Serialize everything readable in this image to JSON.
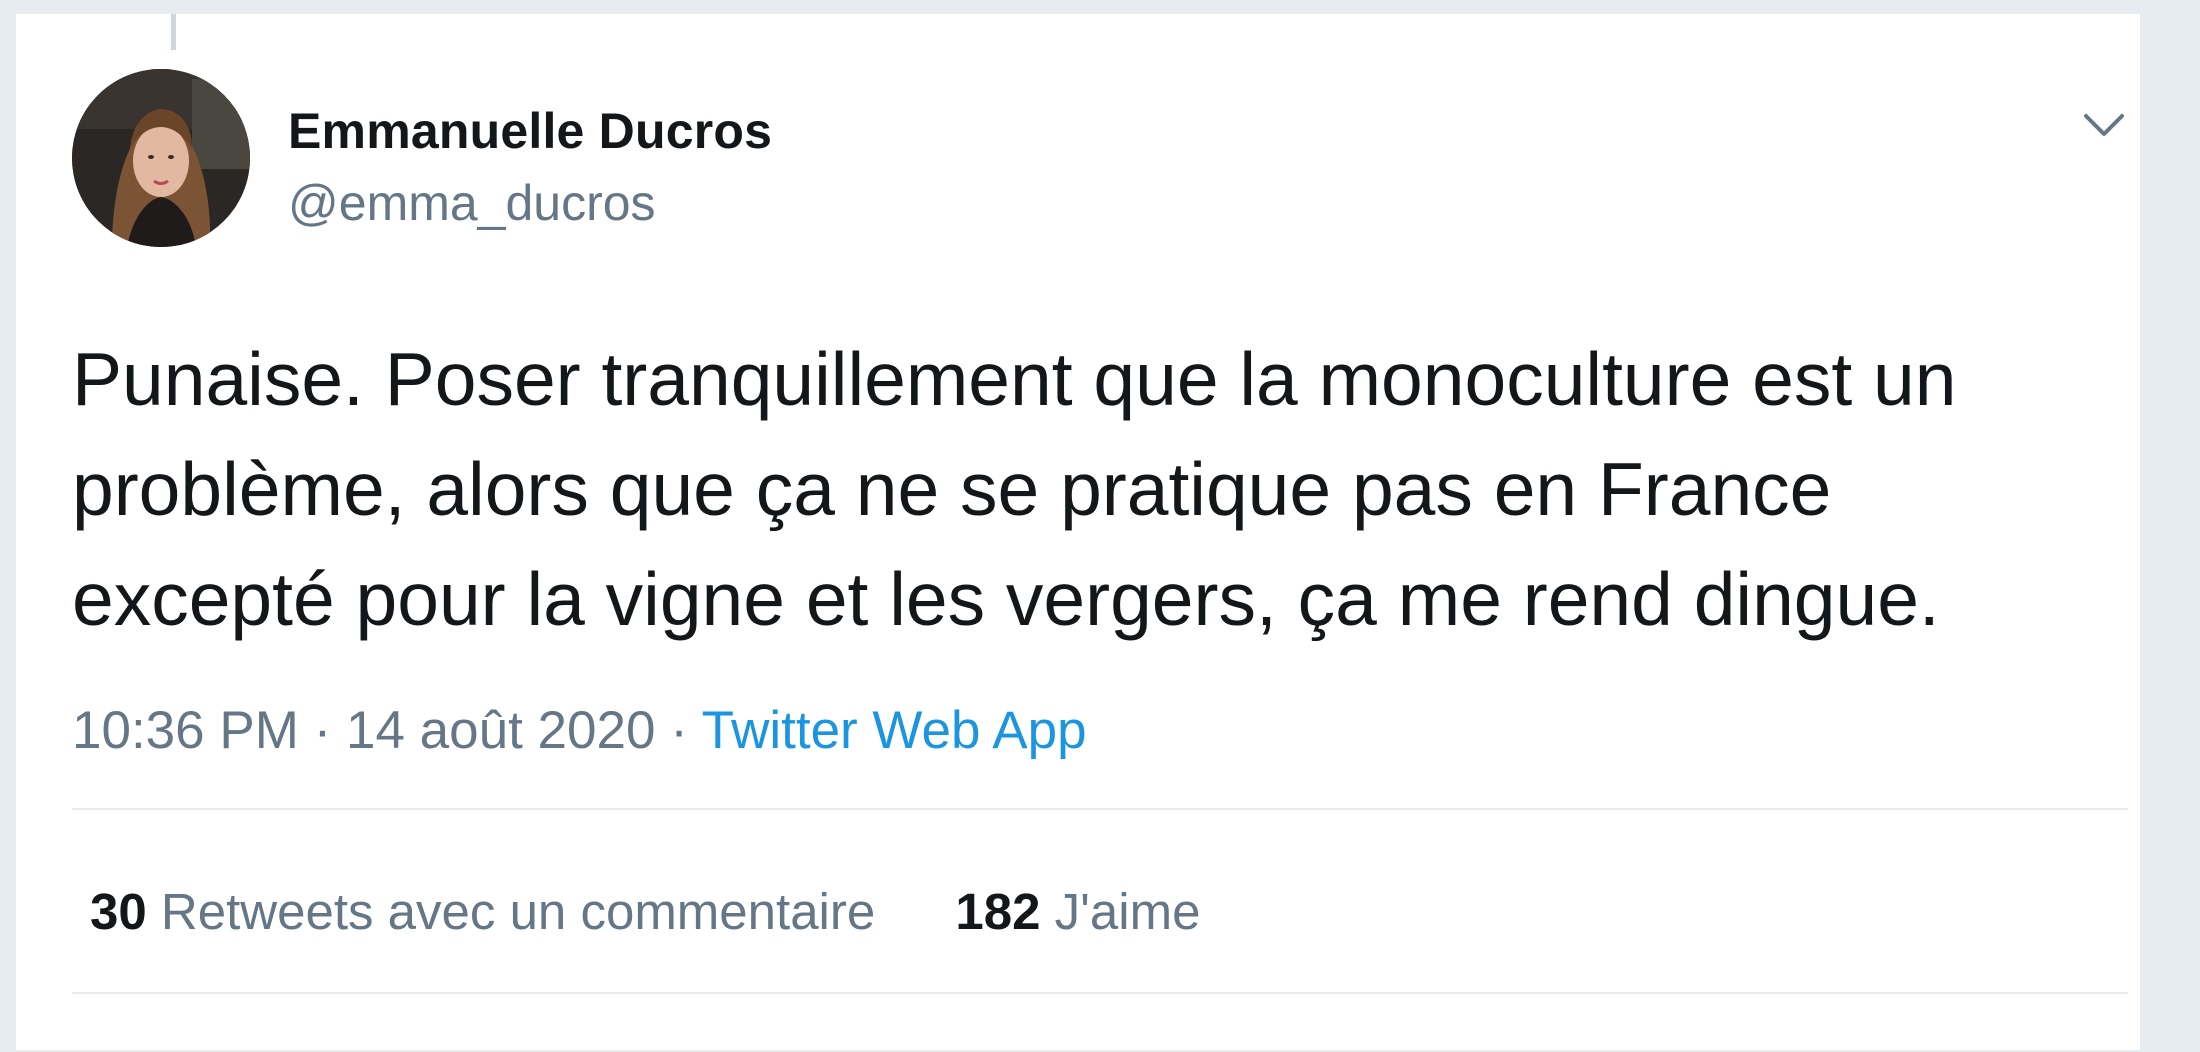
{
  "author": {
    "name": "Emmanuelle Ducros",
    "handle": "@emma_ducros"
  },
  "tweet": {
    "lines": [
      "Punaise. Poser tranquillement que la monoculture est un",
      "problème, alors que ça ne se pratique pas en France",
      "excepté pour la vigne et les vergers, ça me rend dingue."
    ]
  },
  "meta": {
    "time": "10:36 PM",
    "separator": "·",
    "date": "14 août 2020",
    "source": "Twitter Web App"
  },
  "stats": {
    "retweets_count": "30",
    "retweets_label": "Retweets avec un commentaire",
    "likes_count": "182",
    "likes_label": "J'aime"
  },
  "icons": {
    "menu": "chevron-down-icon"
  },
  "colors": {
    "text": "#14171a",
    "secondary": "#657786",
    "link": "#1b95e0",
    "divider": "#e6ecf0"
  }
}
